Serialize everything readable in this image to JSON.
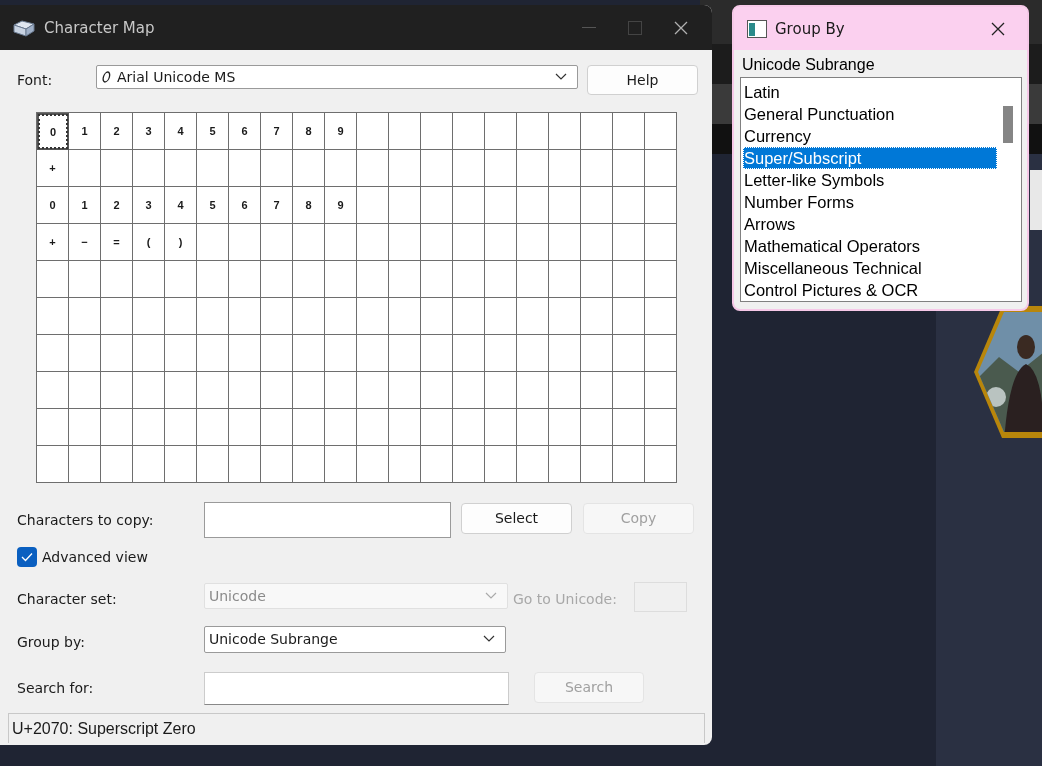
{
  "char_map": {
    "window": {
      "title": "Character Map"
    },
    "font": {
      "label": "Font:",
      "value": "Arial Unicode MS"
    },
    "help_button": {
      "label": "Help",
      "disabled": false
    },
    "grid": {
      "rows": [
        [
          {
            "char": "0",
            "selected": true
          },
          {
            "char": "1",
            "selected": false
          },
          {
            "char": "2",
            "selected": false
          },
          {
            "char": "3",
            "selected": false
          },
          {
            "char": "4",
            "selected": false
          },
          {
            "char": "5",
            "selected": false
          },
          {
            "char": "6",
            "selected": false
          },
          {
            "char": "7",
            "selected": false
          },
          {
            "char": "8",
            "selected": false
          },
          {
            "char": "9",
            "selected": false
          }
        ],
        [
          {
            "char": "+",
            "selected": false
          }
        ],
        [
          {
            "char": "0",
            "selected": false
          },
          {
            "char": "1",
            "selected": false
          },
          {
            "char": "2",
            "selected": false
          },
          {
            "char": "3",
            "selected": false
          },
          {
            "char": "4",
            "selected": false
          },
          {
            "char": "5",
            "selected": false
          },
          {
            "char": "6",
            "selected": false
          },
          {
            "char": "7",
            "selected": false
          },
          {
            "char": "8",
            "selected": false
          },
          {
            "char": "9",
            "selected": false
          }
        ],
        [
          {
            "char": "+",
            "selected": false
          },
          {
            "char": "−",
            "selected": false
          },
          {
            "char": "=",
            "selected": false
          },
          {
            "char": "(",
            "selected": false
          },
          {
            "char": ")",
            "selected": false
          }
        ]
      ]
    },
    "copy_row": {
      "label": "Characters to copy:",
      "buttons": [
        {
          "label": "Select",
          "disabled": false
        },
        {
          "label": "Copy",
          "disabled": true
        }
      ]
    },
    "advanced_view": {
      "label": "Advanced view",
      "checked": true
    },
    "character_set": {
      "label": "Character set:",
      "value": "Unicode",
      "disabled": true,
      "goto_label": "Go to Unicode:"
    },
    "group_by": {
      "label": "Group by:",
      "value": "Unicode Subrange",
      "disabled": false
    },
    "search": {
      "label": "Search for:",
      "button": {
        "label": "Search",
        "disabled": true
      }
    },
    "status_bar": "U+2070: Superscript Zero"
  },
  "group_by_popup": {
    "window": {
      "title": "Group By"
    },
    "heading": "Unicode Subrange",
    "items": [
      {
        "label": "Latin",
        "selected": false
      },
      {
        "label": "General Punctuation",
        "selected": false
      },
      {
        "label": "Currency",
        "selected": false
      },
      {
        "label": "Super/Subscript",
        "selected": true
      },
      {
        "label": "Letter-like Symbols",
        "selected": false
      },
      {
        "label": "Number Forms",
        "selected": false
      },
      {
        "label": "Arrows",
        "selected": false
      },
      {
        "label": "Mathematical Operators",
        "selected": false
      },
      {
        "label": "Miscellaneous Technical",
        "selected": false
      },
      {
        "label": "Control Pictures & OCR",
        "selected": false
      }
    ]
  }
}
